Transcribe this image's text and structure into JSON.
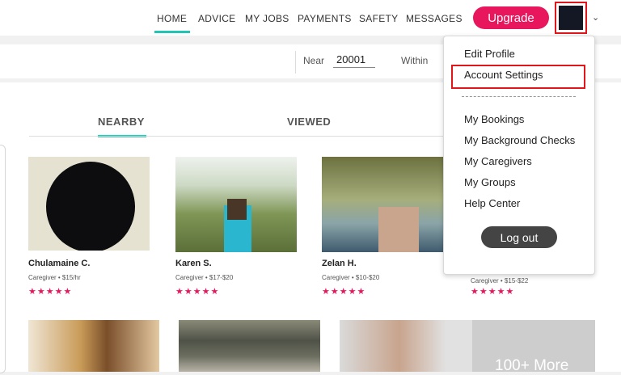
{
  "nav": {
    "items": [
      "HOME",
      "ADVICE",
      "MY JOBS",
      "PAYMENTS",
      "SAFETY",
      "MESSAGES"
    ],
    "active": "HOME",
    "upgrade_label": "Upgrade"
  },
  "search": {
    "near_label": "Near",
    "near_value": "20001",
    "within_label": "Within"
  },
  "tabs": [
    "NEARBY",
    "VIEWED"
  ],
  "caregivers": [
    {
      "name": "Chulamaine C.",
      "meta": "Caregiver • $15/hr",
      "rating": "★★★★★"
    },
    {
      "name": "Karen S.",
      "meta": "Caregiver • $17-$20",
      "rating": "★★★★★"
    },
    {
      "name": "Zelan H.",
      "meta": "Caregiver • $10-$20",
      "rating": "★★★★★"
    },
    {
      "name": "",
      "meta": "Caregiver • $15-$22",
      "rating": "★★★★★"
    }
  ],
  "more_label": "100+ More",
  "dropdown": {
    "items": [
      "Edit Profile",
      "Account Settings",
      "My Bookings",
      "My Background Checks",
      "My Caregivers",
      "My Groups",
      "Help Center"
    ],
    "logout_label": "Log out"
  },
  "colors": {
    "accent_teal": "#1ec6b3",
    "brand_pink": "#e8175d",
    "highlight_red": "#e1161a"
  }
}
